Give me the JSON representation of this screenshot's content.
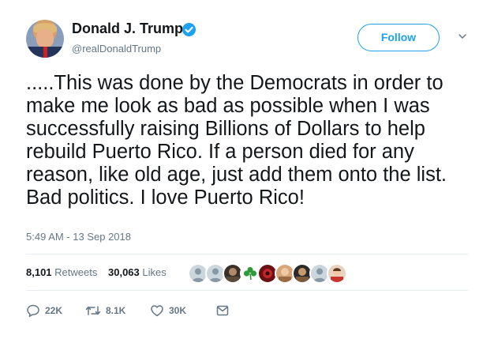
{
  "author": {
    "name": "Donald J. Trump",
    "handle": "@realDonaldTrump",
    "verified": true,
    "verified_color": "#1da1f2"
  },
  "follow_button": {
    "label": "Follow"
  },
  "menu": {
    "icon": "chevron-down-icon"
  },
  "tweet": {
    "text": ".....This was done by the Democrats in order to make me look as bad as possible when I was successfully raising Billions of Dollars to help rebuild Puerto Rico. If a person died for any reason, like old age, just add them onto the list. Bad politics. I love Puerto Rico!",
    "timestamp": "5:49 AM - 13 Sep 2018"
  },
  "stats": {
    "retweets_count": "8,101",
    "retweets_label": "Retweets",
    "likes_count": "30,063",
    "likes_label": "Likes"
  },
  "likers": [
    {
      "icon": "default-avatar-icon"
    },
    {
      "icon": "default-avatar-icon"
    },
    {
      "icon": "user-photo-icon"
    },
    {
      "icon": "shamrock-icon"
    },
    {
      "icon": "user-photo-icon"
    },
    {
      "icon": "user-photo-icon"
    },
    {
      "icon": "user-photo-icon"
    },
    {
      "icon": "default-avatar-icon"
    },
    {
      "icon": "user-photo-icon"
    }
  ],
  "actions": {
    "reply_count": "22K",
    "retweet_count": "8.1K",
    "like_count": "30K",
    "message_icon": "envelope-icon"
  },
  "colors": {
    "accent": "#1da1f2",
    "muted": "#657786",
    "text": "#14171a",
    "divider": "#e6ecf0"
  }
}
